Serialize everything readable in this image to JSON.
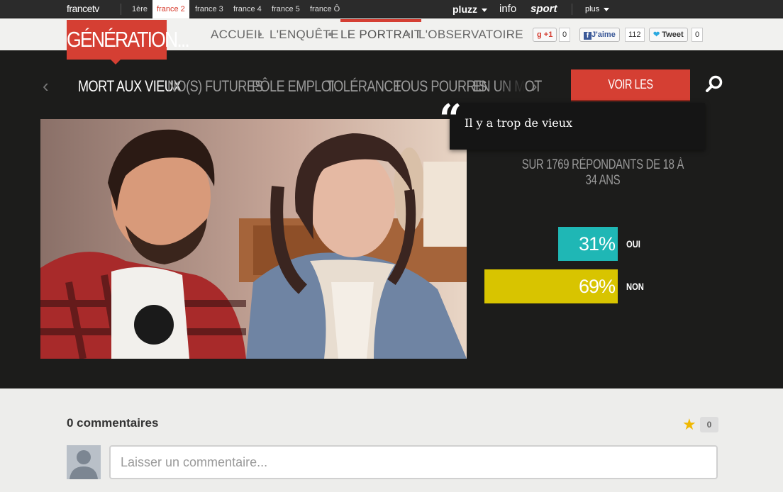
{
  "topbar": {
    "logo": "francetv",
    "channels": [
      "1ère",
      "france 2",
      "france 3",
      "france 4",
      "france 5",
      "france Ô"
    ],
    "active_channel": "france 2",
    "pluzz": "pluzz",
    "info": "info",
    "sport": "sport",
    "plus": "plus"
  },
  "header": {
    "brand": "GÉNÉRATION...",
    "nav": [
      "ACCUEIL",
      "L'ENQUÊTE",
      "LE PORTRAIT",
      "L'OBSERVATOIRE"
    ],
    "active_nav": "LE PORTRAIT",
    "social": {
      "gplus_label": "+1",
      "gplus_count": "0",
      "fb_label": "J'aime",
      "fb_count": "112",
      "tw_label": "Tweet",
      "tw_count": "0"
    }
  },
  "topics": {
    "items": [
      "MORT AUX VIEUX",
      "NO(S) FUTURES",
      "PÔLE EMPLOI",
      "TOLÉRANCE",
      "TOUS POURRIS",
      "EN UN MOT"
    ],
    "active": "MORT AUX VIEUX",
    "data_button": "VOIR LES DONNÉES"
  },
  "survey": {
    "quote": "Il y a trop de vieux",
    "respondents": "SUR 1769 RÉPONDANTS DE 18 À 34 ANS",
    "results": [
      {
        "label": "OUI",
        "percent": 31,
        "percent_text": "31%",
        "color": "#1fb7b5"
      },
      {
        "label": "NON",
        "percent": 69,
        "percent_text": "69%",
        "color": "#d8c400"
      }
    ]
  },
  "comments": {
    "title": "0 commentaires",
    "favorites": "0",
    "placeholder": "Laisser un commentaire..."
  }
}
